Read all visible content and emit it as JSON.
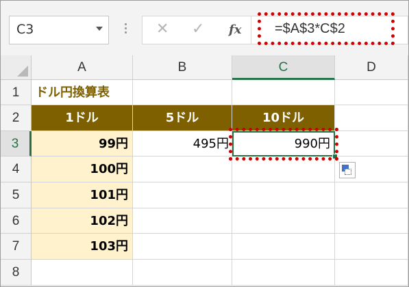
{
  "name_box": {
    "value": "C3"
  },
  "formula_bar": {
    "cancel_icon": "✕",
    "enter_icon": "✓",
    "fx_label": "fx",
    "formula": "=$A$3*C$2"
  },
  "columns": [
    "A",
    "B",
    "C",
    "D"
  ],
  "rows": [
    "1",
    "2",
    "3",
    "4",
    "5",
    "6",
    "7",
    "8"
  ],
  "selected": {
    "column": "C",
    "row": "3"
  },
  "cells": {
    "A1": "ドル円換算表",
    "A2": "1ドル",
    "B2": "5ドル",
    "C2": "10ドル",
    "A3": "99円",
    "B3": "495円",
    "C3": "990円",
    "A4": "100円",
    "A5": "101円",
    "A6": "102円",
    "A7": "103円"
  },
  "colors": {
    "header_fill": "#7f6000",
    "rate_fill": "#fff2cc",
    "selection": "#217346",
    "highlight": "#d00000"
  },
  "icons": [
    "name-box-dropdown-icon",
    "cancel-icon",
    "enter-icon",
    "fx-icon",
    "paste-options-icon"
  ]
}
